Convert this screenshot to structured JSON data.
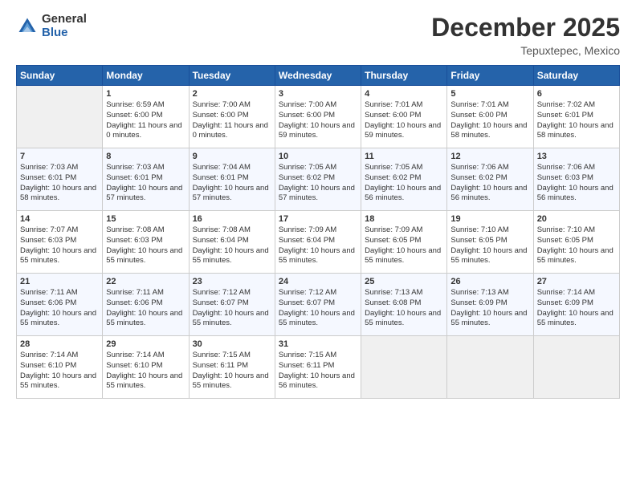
{
  "header": {
    "logo_general": "General",
    "logo_blue": "Blue",
    "month_title": "December 2025",
    "location": "Tepuxtepec, Mexico"
  },
  "weekdays": [
    "Sunday",
    "Monday",
    "Tuesday",
    "Wednesday",
    "Thursday",
    "Friday",
    "Saturday"
  ],
  "weeks": [
    [
      {
        "day": "",
        "empty": true
      },
      {
        "day": "1",
        "sunrise": "Sunrise: 6:59 AM",
        "sunset": "Sunset: 6:00 PM",
        "daylight": "Daylight: 11 hours and 0 minutes."
      },
      {
        "day": "2",
        "sunrise": "Sunrise: 7:00 AM",
        "sunset": "Sunset: 6:00 PM",
        "daylight": "Daylight: 11 hours and 0 minutes."
      },
      {
        "day": "3",
        "sunrise": "Sunrise: 7:00 AM",
        "sunset": "Sunset: 6:00 PM",
        "daylight": "Daylight: 10 hours and 59 minutes."
      },
      {
        "day": "4",
        "sunrise": "Sunrise: 7:01 AM",
        "sunset": "Sunset: 6:00 PM",
        "daylight": "Daylight: 10 hours and 59 minutes."
      },
      {
        "day": "5",
        "sunrise": "Sunrise: 7:01 AM",
        "sunset": "Sunset: 6:00 PM",
        "daylight": "Daylight: 10 hours and 58 minutes."
      },
      {
        "day": "6",
        "sunrise": "Sunrise: 7:02 AM",
        "sunset": "Sunset: 6:01 PM",
        "daylight": "Daylight: 10 hours and 58 minutes."
      }
    ],
    [
      {
        "day": "7",
        "sunrise": "Sunrise: 7:03 AM",
        "sunset": "Sunset: 6:01 PM",
        "daylight": "Daylight: 10 hours and 58 minutes."
      },
      {
        "day": "8",
        "sunrise": "Sunrise: 7:03 AM",
        "sunset": "Sunset: 6:01 PM",
        "daylight": "Daylight: 10 hours and 57 minutes."
      },
      {
        "day": "9",
        "sunrise": "Sunrise: 7:04 AM",
        "sunset": "Sunset: 6:01 PM",
        "daylight": "Daylight: 10 hours and 57 minutes."
      },
      {
        "day": "10",
        "sunrise": "Sunrise: 7:05 AM",
        "sunset": "Sunset: 6:02 PM",
        "daylight": "Daylight: 10 hours and 57 minutes."
      },
      {
        "day": "11",
        "sunrise": "Sunrise: 7:05 AM",
        "sunset": "Sunset: 6:02 PM",
        "daylight": "Daylight: 10 hours and 56 minutes."
      },
      {
        "day": "12",
        "sunrise": "Sunrise: 7:06 AM",
        "sunset": "Sunset: 6:02 PM",
        "daylight": "Daylight: 10 hours and 56 minutes."
      },
      {
        "day": "13",
        "sunrise": "Sunrise: 7:06 AM",
        "sunset": "Sunset: 6:03 PM",
        "daylight": "Daylight: 10 hours and 56 minutes."
      }
    ],
    [
      {
        "day": "14",
        "sunrise": "Sunrise: 7:07 AM",
        "sunset": "Sunset: 6:03 PM",
        "daylight": "Daylight: 10 hours and 55 minutes."
      },
      {
        "day": "15",
        "sunrise": "Sunrise: 7:08 AM",
        "sunset": "Sunset: 6:03 PM",
        "daylight": "Daylight: 10 hours and 55 minutes."
      },
      {
        "day": "16",
        "sunrise": "Sunrise: 7:08 AM",
        "sunset": "Sunset: 6:04 PM",
        "daylight": "Daylight: 10 hours and 55 minutes."
      },
      {
        "day": "17",
        "sunrise": "Sunrise: 7:09 AM",
        "sunset": "Sunset: 6:04 PM",
        "daylight": "Daylight: 10 hours and 55 minutes."
      },
      {
        "day": "18",
        "sunrise": "Sunrise: 7:09 AM",
        "sunset": "Sunset: 6:05 PM",
        "daylight": "Daylight: 10 hours and 55 minutes."
      },
      {
        "day": "19",
        "sunrise": "Sunrise: 7:10 AM",
        "sunset": "Sunset: 6:05 PM",
        "daylight": "Daylight: 10 hours and 55 minutes."
      },
      {
        "day": "20",
        "sunrise": "Sunrise: 7:10 AM",
        "sunset": "Sunset: 6:05 PM",
        "daylight": "Daylight: 10 hours and 55 minutes."
      }
    ],
    [
      {
        "day": "21",
        "sunrise": "Sunrise: 7:11 AM",
        "sunset": "Sunset: 6:06 PM",
        "daylight": "Daylight: 10 hours and 55 minutes."
      },
      {
        "day": "22",
        "sunrise": "Sunrise: 7:11 AM",
        "sunset": "Sunset: 6:06 PM",
        "daylight": "Daylight: 10 hours and 55 minutes."
      },
      {
        "day": "23",
        "sunrise": "Sunrise: 7:12 AM",
        "sunset": "Sunset: 6:07 PM",
        "daylight": "Daylight: 10 hours and 55 minutes."
      },
      {
        "day": "24",
        "sunrise": "Sunrise: 7:12 AM",
        "sunset": "Sunset: 6:07 PM",
        "daylight": "Daylight: 10 hours and 55 minutes."
      },
      {
        "day": "25",
        "sunrise": "Sunrise: 7:13 AM",
        "sunset": "Sunset: 6:08 PM",
        "daylight": "Daylight: 10 hours and 55 minutes."
      },
      {
        "day": "26",
        "sunrise": "Sunrise: 7:13 AM",
        "sunset": "Sunset: 6:09 PM",
        "daylight": "Daylight: 10 hours and 55 minutes."
      },
      {
        "day": "27",
        "sunrise": "Sunrise: 7:14 AM",
        "sunset": "Sunset: 6:09 PM",
        "daylight": "Daylight: 10 hours and 55 minutes."
      }
    ],
    [
      {
        "day": "28",
        "sunrise": "Sunrise: 7:14 AM",
        "sunset": "Sunset: 6:10 PM",
        "daylight": "Daylight: 10 hours and 55 minutes."
      },
      {
        "day": "29",
        "sunrise": "Sunrise: 7:14 AM",
        "sunset": "Sunset: 6:10 PM",
        "daylight": "Daylight: 10 hours and 55 minutes."
      },
      {
        "day": "30",
        "sunrise": "Sunrise: 7:15 AM",
        "sunset": "Sunset: 6:11 PM",
        "daylight": "Daylight: 10 hours and 55 minutes."
      },
      {
        "day": "31",
        "sunrise": "Sunrise: 7:15 AM",
        "sunset": "Sunset: 6:11 PM",
        "daylight": "Daylight: 10 hours and 56 minutes."
      },
      {
        "day": "",
        "empty": true
      },
      {
        "day": "",
        "empty": true
      },
      {
        "day": "",
        "empty": true
      }
    ]
  ]
}
